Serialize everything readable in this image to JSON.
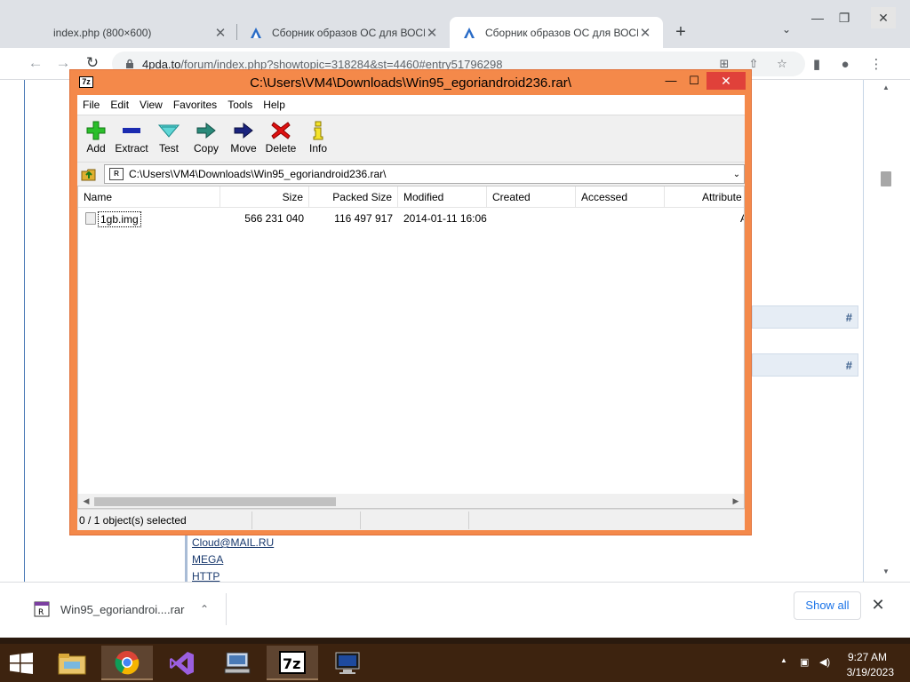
{
  "browser": {
    "tabs": [
      {
        "title": "index.php (800×600)",
        "active": false
      },
      {
        "title": "Сборник образов ОС для ВОСН",
        "active": false
      },
      {
        "title": "Сборник образов ОС для ВОСН",
        "active": true
      }
    ],
    "new_tab_symbol": "+",
    "url_host": "4pda.to",
    "url_path": "/forum/index.php?showtopic=318284&st=4460#entry51796298"
  },
  "page": {
    "links": [
      "Cloud@MAIL.RU",
      "MEGA",
      "HTTP"
    ],
    "anchor_symbol": "#"
  },
  "zip": {
    "title": "C:\\Users\\VM4\\Downloads\\Win95_egoriandroid236.rar\\",
    "app_icon_text": "7z",
    "menu": [
      "File",
      "Edit",
      "View",
      "Favorites",
      "Tools",
      "Help"
    ],
    "tools": [
      {
        "label": "Add",
        "icon": "add-icon"
      },
      {
        "label": "Extract",
        "icon": "extract-icon"
      },
      {
        "label": "Test",
        "icon": "test-icon"
      },
      {
        "label": "Copy",
        "icon": "copy-icon"
      },
      {
        "label": "Move",
        "icon": "move-icon"
      },
      {
        "label": "Delete",
        "icon": "delete-icon"
      },
      {
        "label": "Info",
        "icon": "info-icon"
      }
    ],
    "address": "C:\\Users\\VM4\\Downloads\\Win95_egoriandroid236.rar\\",
    "columns": [
      "Name",
      "Size",
      "Packed Size",
      "Modified",
      "Created",
      "Accessed",
      "Attribute"
    ],
    "rows": [
      {
        "name": "1gb.img",
        "size": "566 231 040",
        "packed": "116 497 917",
        "modified": "2014-01-11 16:06",
        "created": "",
        "accessed": "",
        "attr": "A"
      }
    ],
    "status": "0 / 1 object(s) selected"
  },
  "downloads": {
    "file": "Win95_egoriandroi....rar",
    "show_all": "Show all"
  },
  "taskbar": {
    "time": "9:27 AM",
    "date": "3/19/2023",
    "zip_label": "7z"
  },
  "colors": {
    "zip_frame": "#f4894a",
    "zip_close": "#e0413a",
    "taskbar": "#3d230f",
    "chrome_accent": "#1a73e8"
  }
}
